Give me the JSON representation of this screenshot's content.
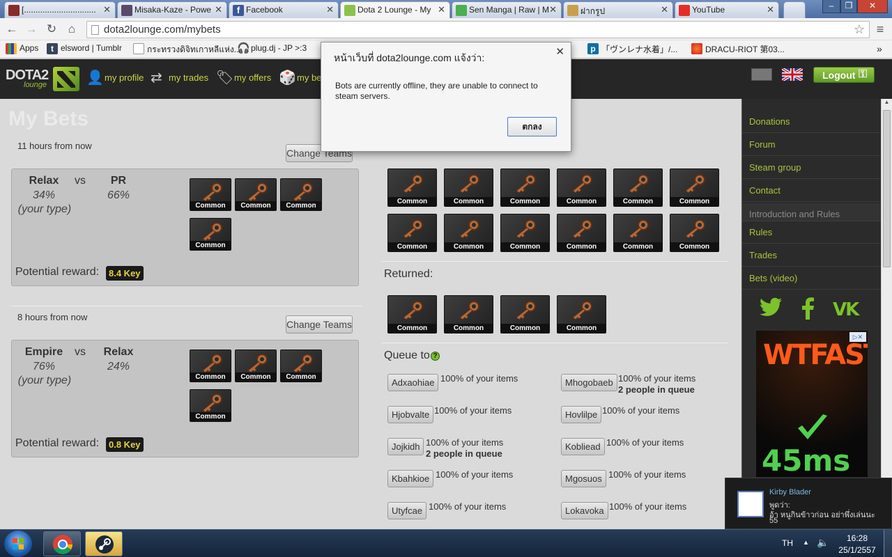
{
  "browser": {
    "tabs": [
      {
        "title": "[..............................."
      },
      {
        "title": "Misaka-Kaze - Powe"
      },
      {
        "title": "Facebook"
      },
      {
        "title": "Dota 2 Lounge - My"
      },
      {
        "title": "Sen Manga | Raw | M"
      },
      {
        "title": "ฝากรูป"
      },
      {
        "title": "YouTube"
      }
    ],
    "url": "dota2lounge.com/mybets",
    "bookmarks": [
      {
        "label": "Apps"
      },
      {
        "label": "elsword | Tumblr"
      },
      {
        "label": "กระทรวงดิจิทเกาหลีแห่ง..."
      },
      {
        "label": "plug.dj - JP >:3"
      },
      {
        "label": "「ヴンレナ水着」/..."
      },
      {
        "label": "DRACU-RIOT 第03..."
      }
    ]
  },
  "site": {
    "logo_text": "DOTA2",
    "logo_sub": "lounge",
    "nav": [
      {
        "label": "my profile"
      },
      {
        "label": "my trades"
      },
      {
        "label": "my offers"
      },
      {
        "label": "my be"
      }
    ],
    "logout_label": "Logout"
  },
  "page": {
    "title": "My Bets",
    "change_teams_label": "Change Teams",
    "item_label": "Common",
    "potential_reward_label": "Potential reward:",
    "vs_label": "vs",
    "returned_label": "Returned:",
    "queue_label": "Queue to",
    "bets": [
      {
        "time": "11 hours from now",
        "team1": "Relax",
        "team2": "PR",
        "pct1": "34%",
        "pct2": "66%",
        "your_type": "(your type)",
        "reward": "8.4 Key"
      },
      {
        "time": "8 hours from now",
        "team1": "Empire",
        "team2": "Relax",
        "pct1": "76%",
        "pct2": "24%",
        "your_type": "(your type)",
        "reward": "0.8 Key"
      }
    ],
    "queue": [
      {
        "name": "Adxaohiae",
        "pct": "100% of your items",
        "sub": ""
      },
      {
        "name": "Mhogobaeb",
        "pct": "100% of your items",
        "sub": "2 people in queue"
      },
      {
        "name": "Hjobvalte",
        "pct": "100% of your items",
        "sub": ""
      },
      {
        "name": "Hovlilpe",
        "pct": "100% of your items",
        "sub": ""
      },
      {
        "name": "Jojkidh",
        "pct": "100% of your items",
        "sub": "2 people in queue"
      },
      {
        "name": "Kobliead",
        "pct": "100% of your items",
        "sub": ""
      },
      {
        "name": "Kbahkioe",
        "pct": "100% of your items",
        "sub": ""
      },
      {
        "name": "Mgosuos",
        "pct": "100% of your items",
        "sub": ""
      },
      {
        "name": "Utyfcae",
        "pct": "100% of your items",
        "sub": ""
      },
      {
        "name": "Lokavoka",
        "pct": "100% of your items",
        "sub": ""
      }
    ]
  },
  "sidebar": {
    "items": [
      {
        "label": "Donations"
      },
      {
        "label": "Forum"
      },
      {
        "label": "Steam group"
      },
      {
        "label": "Contact"
      },
      {
        "label": "Introduction and Rules"
      },
      {
        "label": "Rules"
      },
      {
        "label": "Trades"
      },
      {
        "label": "Bets (video)"
      }
    ],
    "ad": {
      "logo": "WTFAST",
      "ping": "45ms"
    }
  },
  "dialog": {
    "title": "หน้าเว็บที่ dota2lounge.com แจ้งว่า:",
    "message": "Bots are currently offline, they are unable to connect to steam servers.",
    "ok_label": "ตกลง"
  },
  "notification": {
    "name": "Kirby Blader",
    "line1": "พูดว่า:",
    "line2": "อ้า หนูกินข้าวก่อน อย่าพึ่งเล่นนะ",
    "line3": "55"
  },
  "taskbar": {
    "lang": "TH",
    "time": "16:28",
    "date": "25/1/2557"
  }
}
